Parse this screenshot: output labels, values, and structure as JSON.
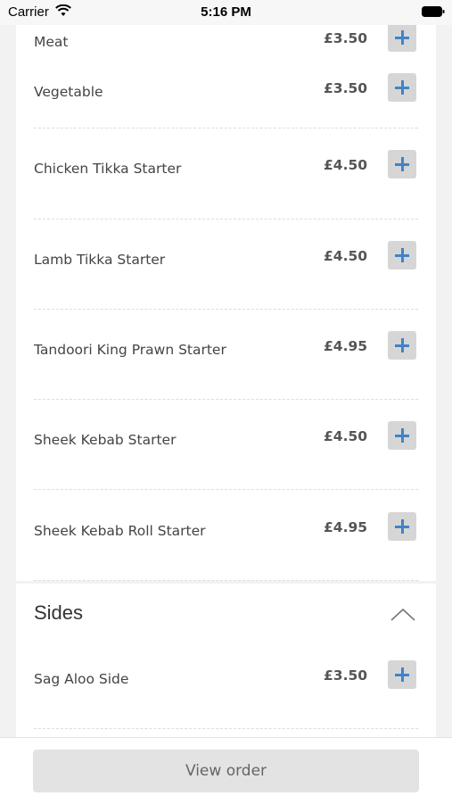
{
  "status_bar": {
    "carrier": "Carrier",
    "time": "5:16 PM",
    "wifi_icon": "wifi-icon",
    "battery_icon": "battery-icon"
  },
  "menu": {
    "items": [
      {
        "name": "Meat",
        "price": "£3.50",
        "add_icon": "plus-icon"
      },
      {
        "name": "Vegetable",
        "price": "£3.50",
        "add_icon": "plus-icon"
      },
      {
        "name": "Chicken Tikka Starter",
        "price": "£4.50",
        "add_icon": "plus-icon"
      },
      {
        "name": "Lamb Tikka Starter",
        "price": "£4.50",
        "add_icon": "plus-icon"
      },
      {
        "name": "Tandoori King Prawn Starter",
        "price": "£4.95",
        "add_icon": "plus-icon"
      },
      {
        "name": "Sheek Kebab Starter",
        "price": "£4.50",
        "add_icon": "plus-icon"
      },
      {
        "name": "Sheek Kebab Roll Starter",
        "price": "£4.95",
        "add_icon": "plus-icon"
      }
    ]
  },
  "sides": {
    "title": "Sides",
    "toggle_icon": "chevron-up-icon",
    "items": [
      {
        "name": "Sag Aloo Side",
        "price": "£3.50",
        "add_icon": "plus-icon"
      }
    ]
  },
  "footer": {
    "view_order_label": "View order"
  },
  "colors": {
    "accent": "#3f83c9",
    "button_bg": "#d6d6d6",
    "page_bg": "#f2f2f2"
  }
}
